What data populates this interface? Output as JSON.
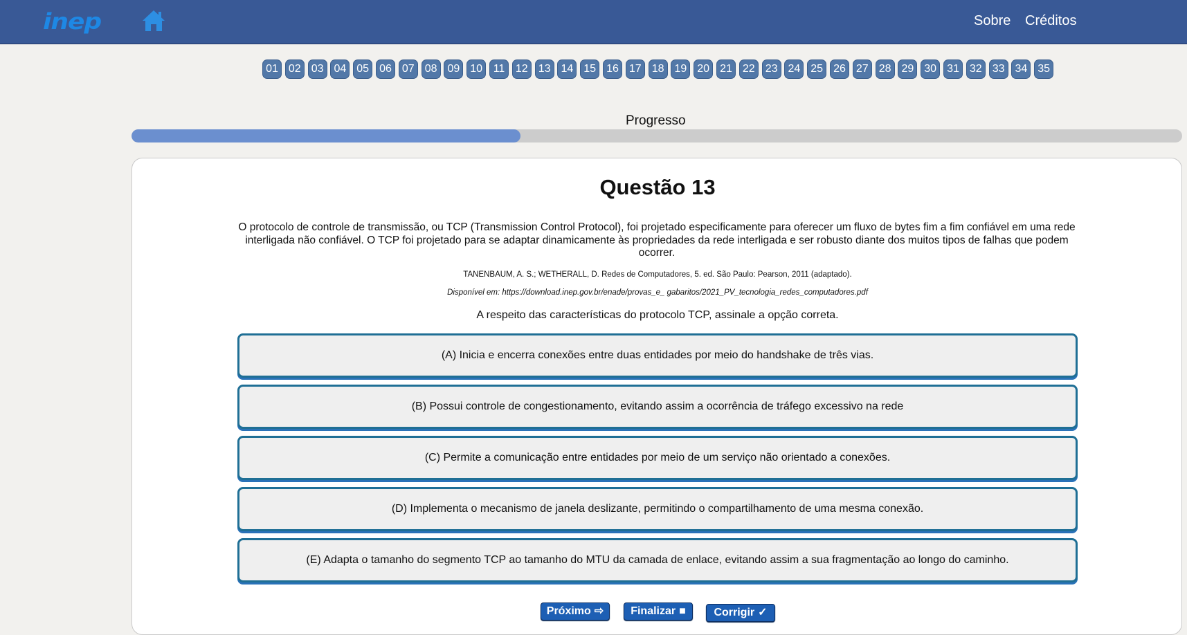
{
  "header": {
    "logo": "inep",
    "home_icon": "home-icon",
    "nav_links": [
      "Sobre",
      "Créditos"
    ]
  },
  "question_nav": [
    "01",
    "02",
    "03",
    "04",
    "05",
    "06",
    "07",
    "08",
    "09",
    "10",
    "11",
    "12",
    "13",
    "14",
    "15",
    "16",
    "17",
    "18",
    "19",
    "20",
    "21",
    "22",
    "23",
    "24",
    "25",
    "26",
    "27",
    "28",
    "29",
    "30",
    "31",
    "32",
    "33",
    "34",
    "35"
  ],
  "progress": {
    "label": "Progresso",
    "value_fraction": 0.37
  },
  "question": {
    "title": "Questão 13",
    "text": "O protocolo de controle de transmissão, ou TCP (Transmission Control Protocol), foi projetado especificamente para oferecer um fluxo de bytes fim a fim confiável em uma rede interligada não confiável. O TCP foi projetado para se adaptar dinamicamente às propriedades da rede interligada e ser robusto diante dos muitos tipos de falhas que podem ocorrer.",
    "reference": "TANENBAUM, A. S.; WETHERALL, D. Redes de Computadores, 5. ed. São Paulo: Pearson, 2011 (adaptado).",
    "source": "Disponível em: https://download.inep.gov.br/enade/provas_e_ gabaritos/2021_PV_tecnologia_redes_computadores.pdf",
    "prompt": "A respeito das características do protocolo TCP, assinale a opção correta.",
    "options": [
      "(A) Inicia e encerra conexões entre duas entidades por meio do handshake de três vias.",
      "(B) Possui controle de congestionamento, evitando assim a ocorrência de tráfego excessivo na rede",
      "(C) Permite a comunicação entre entidades por meio de um serviço não orientado a conexões.",
      "(D) Implementa o mecanismo de janela deslizante, permitindo o compartilhamento de uma mesma conexão.",
      "(E) Adapta o tamanho do segmento TCP ao tamanho do MTU da camada de enlace, evitando assim a sua fragmentação ao longo do caminho."
    ]
  },
  "actions": {
    "next_label": "Próximo",
    "next_icon": "⇨",
    "finish_label": "Finalizar",
    "finish_icon": "■",
    "correct_label": "Corrigir",
    "correct_icon": "✓"
  },
  "colors": {
    "header_bg": "#395996",
    "logo": "#1e88e5",
    "nav_button": "#5278a8",
    "progress_fill": "#6b8fcf",
    "option_border": "#1f6f95",
    "action_button": "#1d5fb4"
  }
}
